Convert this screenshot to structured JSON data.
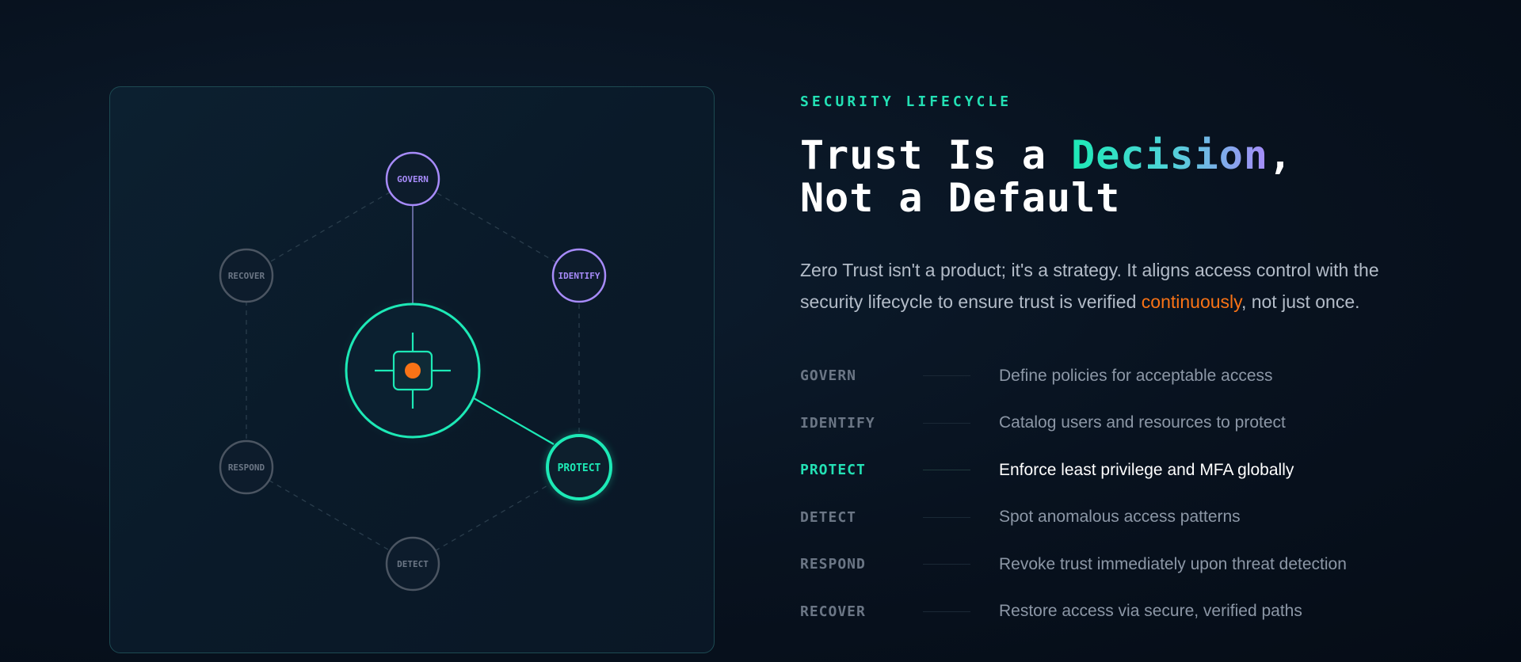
{
  "diagram": {
    "nodes": {
      "govern": "GOVERN",
      "identify": "IDENTIFY",
      "protect": "PROTECT",
      "detect": "DETECT",
      "respond": "RESPOND",
      "recover": "RECOVER"
    },
    "center_icon": "crosshair-target-icon"
  },
  "header": {
    "eyebrow": "SECURITY LIFECYCLE",
    "title_part1": "Trust Is a ",
    "title_highlight": "Decision",
    "title_part2": ",",
    "title_line2": "Not a Default"
  },
  "description": {
    "part1": "Zero Trust isn't a product; it's a strategy. It aligns access control with the security lifecycle to ensure trust is verified ",
    "accent": "continuously",
    "part2": ", not just once."
  },
  "phases": [
    {
      "code": "GOVERN",
      "text": "Define policies for acceptable access"
    },
    {
      "code": "IDENTIFY",
      "text": "Catalog users and resources to protect"
    },
    {
      "code": "PROTECT",
      "text": "Enforce least privilege and MFA globally"
    },
    {
      "code": "DETECT",
      "text": "Spot anomalous access patterns"
    },
    {
      "code": "RESPOND",
      "text": "Revoke trust immediately upon threat detection"
    },
    {
      "code": "RECOVER",
      "text": "Restore access via secure, verified paths"
    }
  ],
  "colors": {
    "accent_teal": "#23e0b4",
    "accent_purple": "#a78bfa",
    "accent_orange": "#f97316"
  }
}
